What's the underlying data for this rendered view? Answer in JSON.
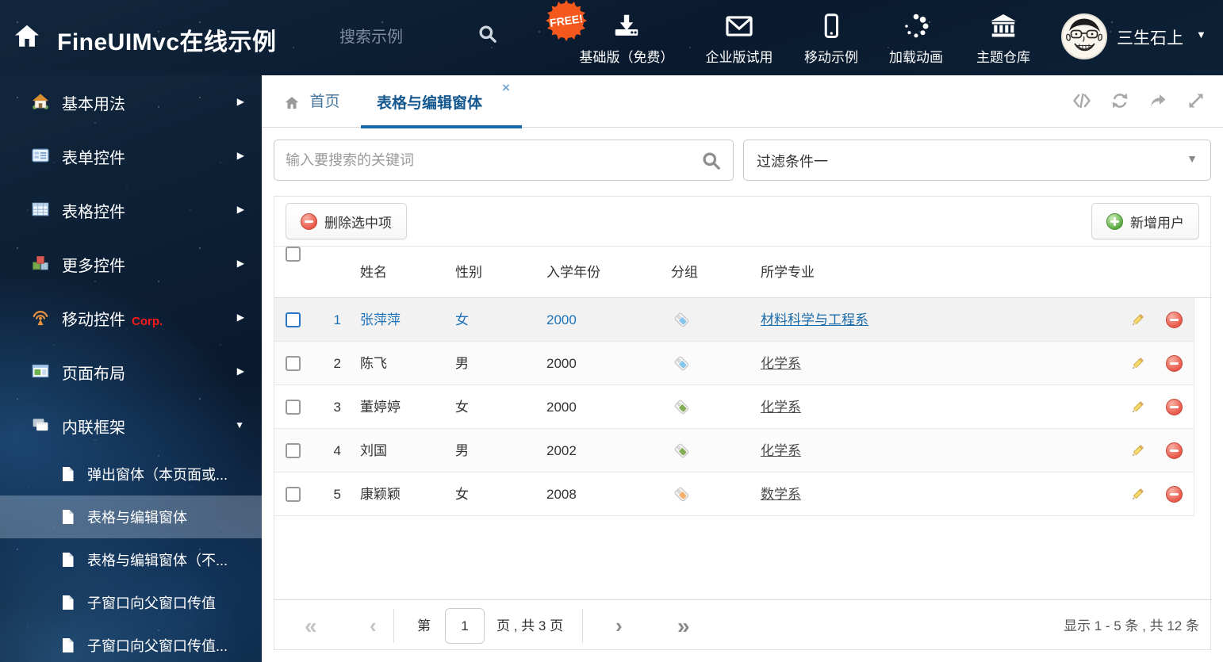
{
  "header": {
    "title": "FineUIMvc在线示例",
    "search_placeholder": "搜索示例",
    "free_badge": "FREE!",
    "nav": [
      {
        "icon": "download-icon",
        "label": "基础版（免费）"
      },
      {
        "icon": "envelope-icon",
        "label": "企业版试用"
      },
      {
        "icon": "mobile-icon",
        "label": "移动示例"
      },
      {
        "icon": "spinner-icon",
        "label": "加载动画"
      },
      {
        "icon": "bank-icon",
        "label": "主题仓库"
      }
    ],
    "user_name": "三生石上"
  },
  "sidebar": {
    "items": [
      {
        "label": "基本用法"
      },
      {
        "label": "表单控件"
      },
      {
        "label": "表格控件"
      },
      {
        "label": "更多控件"
      },
      {
        "label": "移动控件",
        "badge": "Corp."
      },
      {
        "label": "页面布局"
      },
      {
        "label": "内联框架",
        "expanded": true
      }
    ],
    "subitems": [
      {
        "label": "弹出窗体（本页面或..."
      },
      {
        "label": "表格与编辑窗体",
        "active": true
      },
      {
        "label": "表格与编辑窗体（不..."
      },
      {
        "label": "子窗口向父窗口传值"
      },
      {
        "label": "子窗口向父窗口传值..."
      }
    ]
  },
  "tabs": {
    "home_label": "首页",
    "active_label": "表格与编辑窗体"
  },
  "filters": {
    "search_placeholder": "输入要搜索的关键词",
    "filter_value": "过滤条件一"
  },
  "grid": {
    "delete_button": "删除选中项",
    "add_button": "新增用户",
    "columns": [
      "姓名",
      "性别",
      "入学年份",
      "分组",
      "所学专业"
    ],
    "rows": [
      {
        "index": "1",
        "name": "张萍萍",
        "gender": "女",
        "year": "2000",
        "tag_color": "#85c5ee",
        "major": "材料科学与工程系",
        "selected": true
      },
      {
        "index": "2",
        "name": "陈飞",
        "gender": "男",
        "year": "2000",
        "tag_color": "#85c5ee",
        "major": "化学系"
      },
      {
        "index": "3",
        "name": "董婷婷",
        "gender": "女",
        "year": "2000",
        "tag_color": "#83ad52",
        "major": "化学系"
      },
      {
        "index": "4",
        "name": "刘国",
        "gender": "男",
        "year": "2002",
        "tag_color": "#83ad52",
        "major": "化学系"
      },
      {
        "index": "5",
        "name": "康颖颖",
        "gender": "女",
        "year": "2008",
        "tag_color": "#f4b06a",
        "major": "数学系"
      }
    ],
    "pager": {
      "first": "«",
      "prev": "‹",
      "page_prefix": "第",
      "page": "1",
      "page_suffix": "页 , 共 3 页",
      "next": "›",
      "last": "»",
      "summary": "显示 1 - 5 条 , 共 12 条"
    }
  },
  "icons": {
    "arrow_right": "▶",
    "caret_down": "▼",
    "tab_close": "×"
  },
  "colors": {
    "accent_blue": "#1a69a8",
    "selected_row_text": "#1e72b8",
    "delete_red": "#e9594a",
    "add_green": "#56a73d",
    "corp_red": "#ff1a1a"
  }
}
